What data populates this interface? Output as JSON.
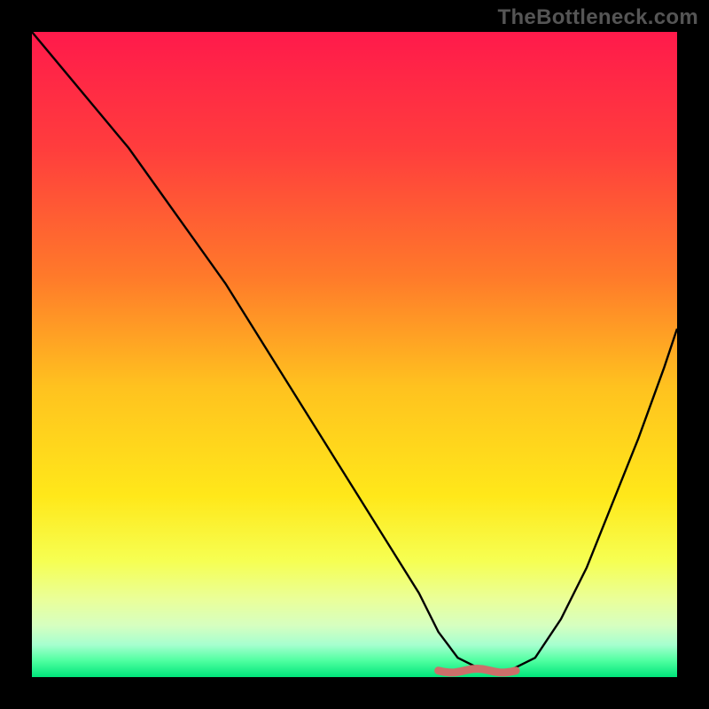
{
  "watermark": "TheBottleneck.com",
  "colors": {
    "frame": "#000000",
    "curve_stroke": "#000000",
    "optimal_marker": "#cc6f6a",
    "gradient_stops": [
      {
        "offset": 0.0,
        "color": "#ff1a4b"
      },
      {
        "offset": 0.18,
        "color": "#ff3d3d"
      },
      {
        "offset": 0.38,
        "color": "#ff7a2a"
      },
      {
        "offset": 0.55,
        "color": "#ffc21f"
      },
      {
        "offset": 0.72,
        "color": "#ffe81a"
      },
      {
        "offset": 0.82,
        "color": "#f6ff52"
      },
      {
        "offset": 0.88,
        "color": "#eaff9a"
      },
      {
        "offset": 0.92,
        "color": "#d6ffc0"
      },
      {
        "offset": 0.95,
        "color": "#a6ffcf"
      },
      {
        "offset": 0.975,
        "color": "#4effa0"
      },
      {
        "offset": 1.0,
        "color": "#00e57a"
      }
    ]
  },
  "chart_data": {
    "type": "line",
    "title": "",
    "xlabel": "",
    "ylabel": "",
    "xlim": [
      0,
      100
    ],
    "ylim": [
      0,
      100
    ],
    "grid": false,
    "legend": false,
    "series": [
      {
        "name": "bottleneck-curve",
        "x": [
          0,
          5,
          10,
          15,
          20,
          25,
          30,
          35,
          40,
          45,
          50,
          55,
          60,
          63,
          66,
          70,
          74,
          78,
          82,
          86,
          90,
          94,
          98,
          100
        ],
        "values": [
          100,
          94,
          88,
          82,
          75,
          68,
          61,
          53,
          45,
          37,
          29,
          21,
          13,
          7,
          3,
          1,
          1,
          3,
          9,
          17,
          27,
          37,
          48,
          54
        ]
      }
    ],
    "annotations": [
      {
        "name": "optimal-range",
        "x_start": 63,
        "x_end": 75,
        "y": 1
      }
    ]
  }
}
